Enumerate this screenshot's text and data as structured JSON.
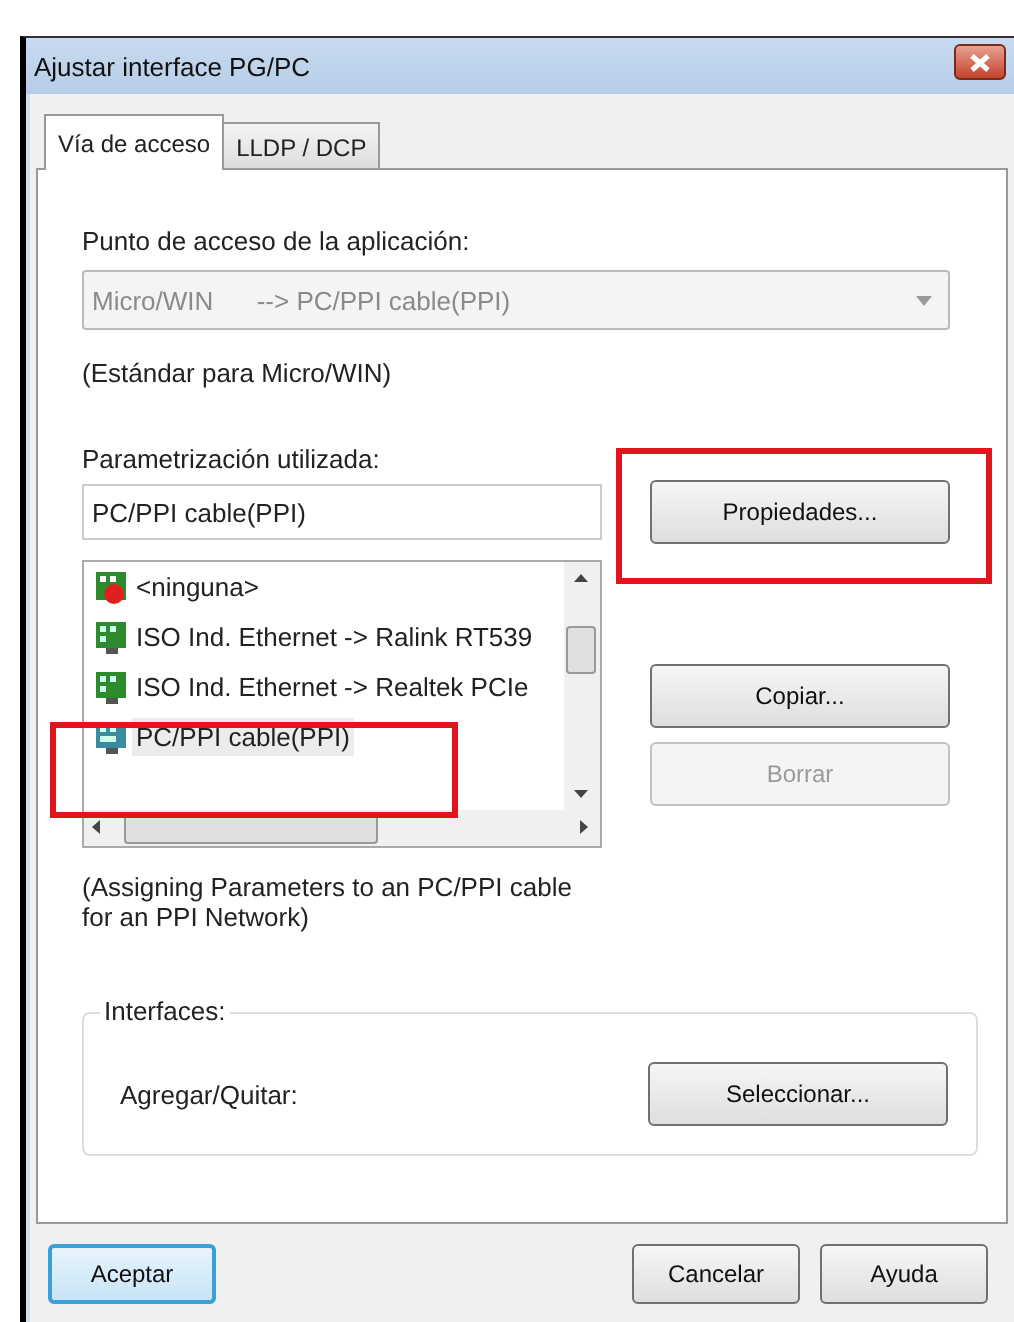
{
  "window": {
    "title": "Ajustar interface PG/PC"
  },
  "tabs": [
    {
      "label": "Vía de acceso",
      "selected": true
    },
    {
      "label": "LLDP / DCP",
      "selected": false
    }
  ],
  "access_point": {
    "label": "Punto de acceso de la aplicación:",
    "value": "Micro/WIN      --> PC/PPI cable(PPI)",
    "disabled": true,
    "note": "(Estándar para Micro/WIN)"
  },
  "parametrization": {
    "label": "Parametrización utilizada:",
    "value": "PC/PPI cable(PPI)"
  },
  "parameter_list": [
    {
      "label": "<ninguna>",
      "kind": "none",
      "selected": false,
      "highlighted": false
    },
    {
      "label": "ISO Ind. Ethernet -> Ralink RT539",
      "kind": "network",
      "selected": false,
      "highlighted": false
    },
    {
      "label": "ISO Ind. Ethernet -> Realtek PCIe",
      "kind": "network",
      "selected": false,
      "highlighted": false
    },
    {
      "label": "PC/PPI cable(PPI)",
      "kind": "cable",
      "selected": true,
      "highlighted": true
    }
  ],
  "side_buttons": [
    {
      "label": "Propiedades...",
      "disabled": false,
      "highlighted": true
    },
    {
      "label": "Copiar...",
      "disabled": false,
      "highlighted": false
    },
    {
      "label": "Borrar",
      "disabled": true,
      "highlighted": false
    }
  ],
  "description": "(Assigning Parameters to an PC/PPI cable\nfor an PPI Network)",
  "interfaces": {
    "title": "Interfaces:",
    "label": "Agregar/Quitar:",
    "button": "Seleccionar..."
  },
  "footer_buttons": [
    {
      "label": "Aceptar",
      "default": true
    },
    {
      "label": "Cancelar",
      "default": false
    },
    {
      "label": "Ayuda",
      "default": false
    }
  ]
}
